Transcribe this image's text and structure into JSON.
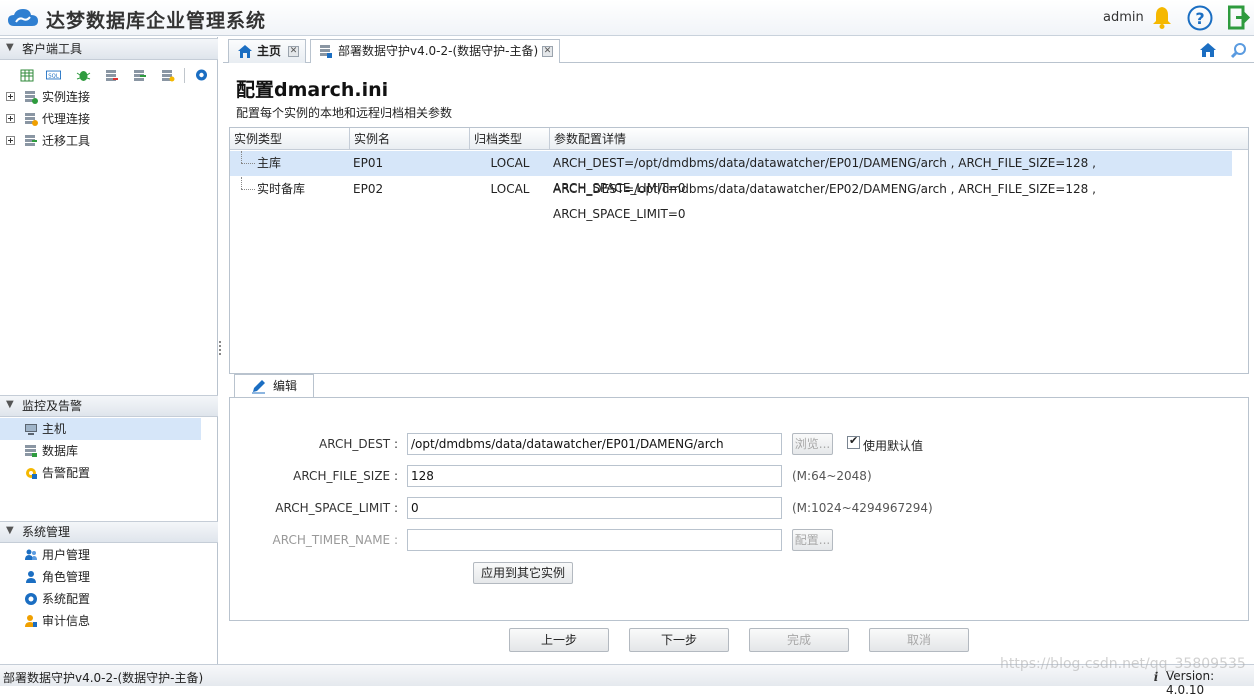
{
  "app": {
    "title": "达梦数据库企业管理系统",
    "user": "admin"
  },
  "left_panel": {
    "client_tools": {
      "header": "客户端工具",
      "items": [
        {
          "label": "实例连接"
        },
        {
          "label": "代理连接"
        },
        {
          "label": "迁移工具"
        }
      ]
    },
    "monitoring": {
      "header": "监控及告警",
      "items": [
        {
          "label": "主机"
        },
        {
          "label": "数据库"
        },
        {
          "label": "告警配置"
        }
      ]
    },
    "system": {
      "header": "系统管理",
      "items": [
        {
          "label": "用户管理"
        },
        {
          "label": "角色管理"
        },
        {
          "label": "系统配置"
        },
        {
          "label": "审计信息"
        }
      ]
    }
  },
  "tabs": [
    {
      "label": "主页"
    },
    {
      "label": "部署数据守护v4.0-2-(数据守护-主备)"
    }
  ],
  "page": {
    "title": "配置dmarch.ini",
    "subtitle": "配置每个实例的本地和远程归档相关参数"
  },
  "grid": {
    "columns": [
      "实例类型",
      "实例名",
      "归档类型",
      "参数配置详情"
    ],
    "rows": [
      {
        "type": "主库",
        "name": "EP01",
        "arch_type": "LOCAL",
        "detail": "ARCH_DEST=/opt/dmdbms/data/datawatcher/EP01/DAMENG/arch , ARCH_FILE_SIZE=128 , ARCH_SPACE_LIMIT=0"
      },
      {
        "type": "实时备库",
        "name": "EP02",
        "arch_type": "LOCAL",
        "detail": "ARCH_DEST=/opt/dmdbms/data/datawatcher/EP02/DAMENG/arch , ARCH_FILE_SIZE=128 , ARCH_SPACE_LIMIT=0"
      }
    ]
  },
  "edit": {
    "tab_label": "编辑",
    "arch_dest": {
      "label": "ARCH_DEST :",
      "value": "/opt/dmdbms/data/datawatcher/EP01/DAMENG/arch",
      "browse": "浏览...",
      "default_label": "使用默认值",
      "default_checked": true
    },
    "arch_file_size": {
      "label": "ARCH_FILE_SIZE :",
      "value": "128",
      "hint": "(M:64~2048)"
    },
    "arch_space_limit": {
      "label": "ARCH_SPACE_LIMIT :",
      "value": "0",
      "hint": "(M:1024~4294967294)"
    },
    "arch_timer_name": {
      "label": "ARCH_TIMER_NAME :",
      "value": "",
      "config": "配置..."
    },
    "apply_button": "应用到其它实例"
  },
  "nav": {
    "prev": "上一步",
    "next": "下一步",
    "finish": "完成",
    "cancel": "取消"
  },
  "status": {
    "left": "部署数据守护v4.0-2-(数据守护-主备)",
    "version": "Version: 4.0.10",
    "watermark": "https://blog.csdn.net/qq_35809535"
  },
  "colors": {
    "accent": "#1b6ec2",
    "bell": "#f5b800",
    "exit": "#2e9b3e",
    "selected_row": "#d6e6f9"
  }
}
